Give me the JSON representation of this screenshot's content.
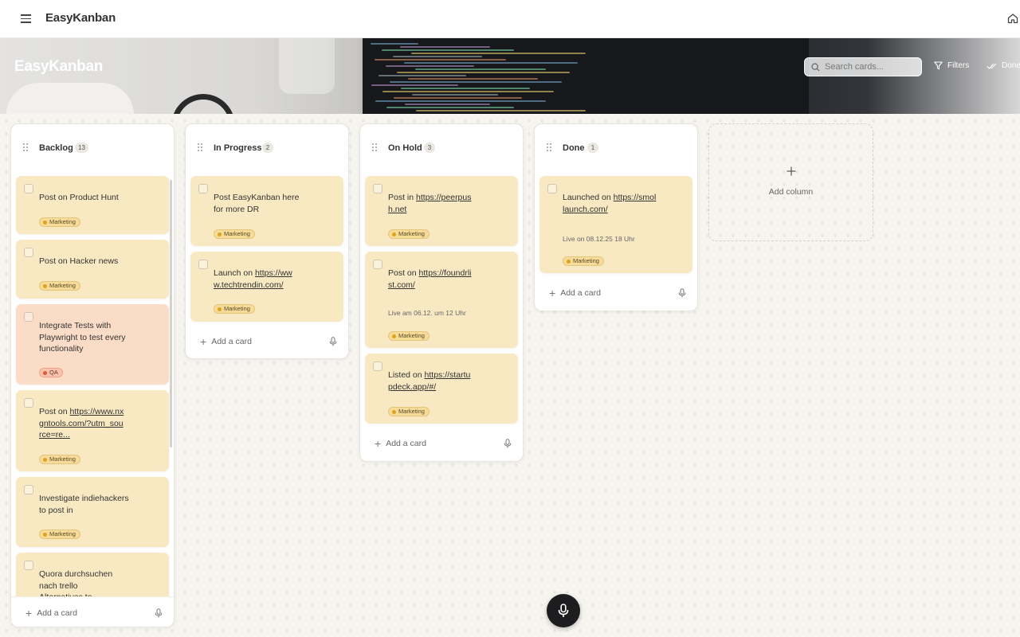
{
  "app": {
    "title": "EasyKanban"
  },
  "header": {
    "board_title": "EasyKanban",
    "search_placeholder": "Search cards...",
    "filters_label": "Filters",
    "done_label": "Done"
  },
  "columns": [
    {
      "title": "Backlog",
      "count": "13",
      "cards": [
        {
          "text": "Post on Product Hunt",
          "tag": "Marketing"
        },
        {
          "text": "Post on Hacker news",
          "tag": "Marketing"
        },
        {
          "text": "Integrate Tests with Playwright to test every functionality",
          "tag": "QA"
        },
        {
          "text_prefix": "Post on ",
          "link": "https://www.nxgntools.com/?utm_source=re...",
          "tag": "Marketing"
        },
        {
          "text": "Investigate indiehackers to post in",
          "tag": "Marketing"
        },
        {
          "text": "Quora durchsuchen nach trello Alternatives to"
        }
      ],
      "add_card_label": "Add a card"
    },
    {
      "title": "In Progress",
      "count": "2",
      "cards": [
        {
          "text": "Post EasyKanban here for more DR",
          "tag": "Marketing"
        },
        {
          "text_prefix": "Launch on ",
          "link": "https://www.techtrendin.com/",
          "tag": "Marketing"
        }
      ],
      "add_card_label": "Add a card"
    },
    {
      "title": "On Hold",
      "count": "3",
      "cards": [
        {
          "text_prefix": "Post in ",
          "link": "https://peerpush.net",
          "tag": "Marketing"
        },
        {
          "text_prefix": "Post on ",
          "link": "https://foundrlist.com/",
          "note": "Live am 06.12. um 12 Uhr",
          "tag": "Marketing"
        },
        {
          "text_prefix": "Listed on ",
          "link": "https://startupdeck.app/#/",
          "tag": "Marketing"
        }
      ],
      "add_card_label": "Add a card"
    },
    {
      "title": "Done",
      "count": "1",
      "cards": [
        {
          "text_prefix": "Launched on ",
          "link": "https://smollaunch.com/",
          "note": "Live on 08.12.25 18 Uhr",
          "tag": "Marketing"
        }
      ],
      "add_card_label": "Add a card"
    }
  ],
  "add_column_label": "Add column",
  "icons": {
    "menu": "hamburger-icon",
    "home": "home-icon",
    "search": "search-icon",
    "filter": "filter-icon",
    "done": "double-check-icon",
    "drag": "drag-handle-icon",
    "mic": "microphone-icon",
    "plus": "plus-icon"
  },
  "colors": {
    "card_marketing": "#f8e9c3",
    "card_qa": "#fbdcc7",
    "tag_marketing_dot": "#e0a21b",
    "tag_qa_dot": "#e0583a",
    "fab": "#1d1d1f"
  }
}
